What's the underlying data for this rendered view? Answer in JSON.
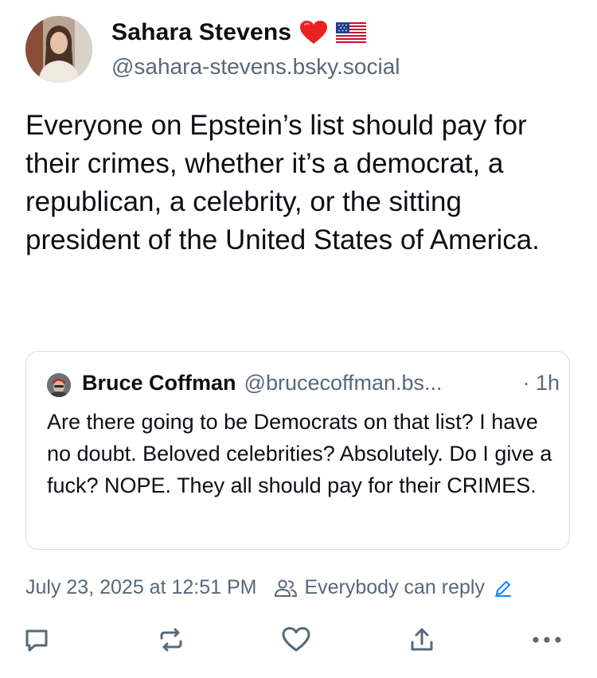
{
  "author": {
    "display_name": "Sahara Stevens",
    "handle": "@sahara-stevens.bsky.social",
    "badges": [
      "red-heart-emoji",
      "us-flag-emoji"
    ]
  },
  "post": {
    "text": "Everyone on Epstein’s list should pay for their crimes, whether it’s a democrat, a republican, a celebrity, or the sitting president of the United States of America."
  },
  "quoted_post": {
    "display_name": "Bruce Coffman",
    "handle": "@brucecoffman.bs...",
    "time": "· 1h",
    "text": "Are there going to be Democrats on that list? I have no doubt. Beloved celebrities? Absolutely. Do I give a fuck? NOPE. They all should pay for their CRIMES."
  },
  "meta": {
    "timestamp": "July 23, 2025 at 12:51 PM",
    "reply_setting": "Everybody can reply"
  },
  "actions": {
    "icons": [
      "reply-icon",
      "repost-icon",
      "like-icon",
      "share-icon",
      "more-icon"
    ]
  },
  "colors": {
    "text": "#0b0f14",
    "secondary": "#57687a",
    "accent": "#1083fe",
    "border": "#d9dee4"
  }
}
